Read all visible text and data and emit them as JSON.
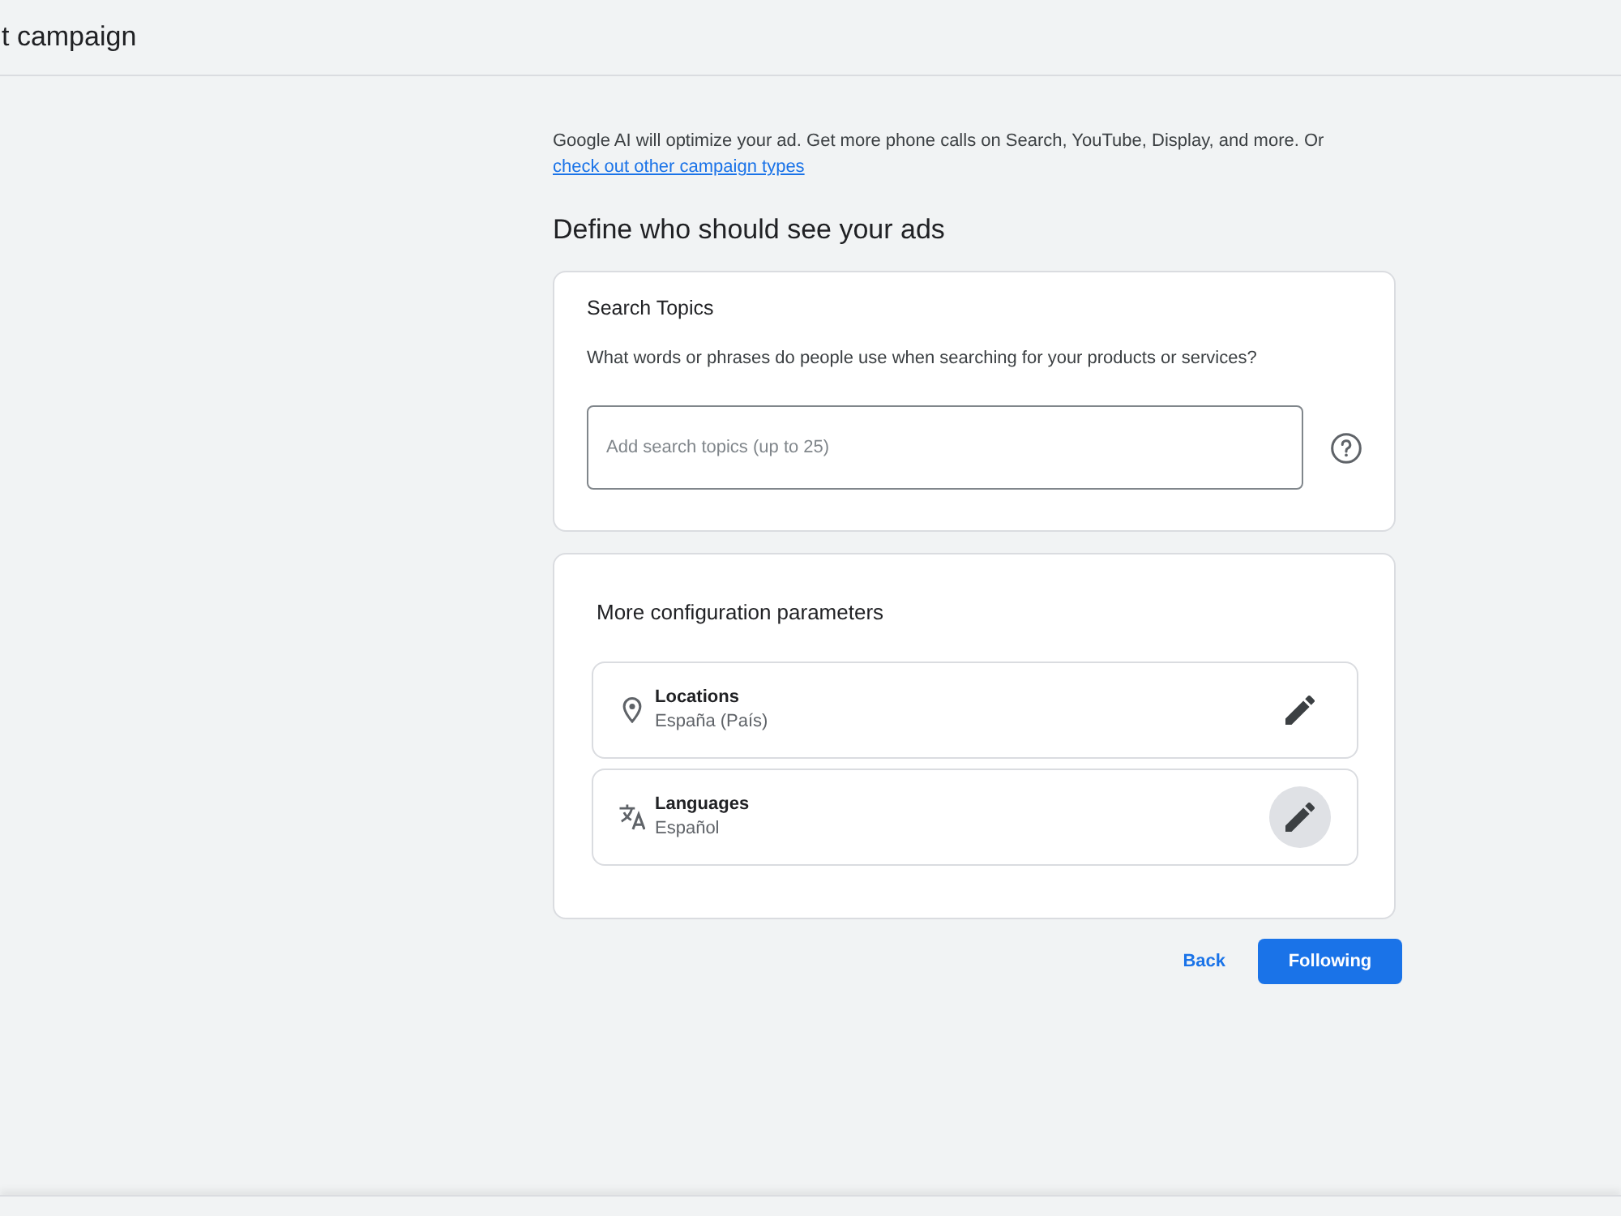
{
  "header": {
    "title": "t campaign"
  },
  "intro": {
    "text": "Google AI will optimize your ad. Get more phone calls on Search, YouTube, Display, and more. Or",
    "link": "check out other campaign types"
  },
  "heading": "Define who should see your ads",
  "search_topics": {
    "title": "Search Topics",
    "question": "What words or phrases do people use when searching for your products or services?",
    "placeholder": "Add search topics (up to 25)"
  },
  "config": {
    "title": "More configuration parameters",
    "items": [
      {
        "kind": "location",
        "label": "Locations",
        "value": "España (País)",
        "hovered": false
      },
      {
        "kind": "language",
        "label": "Languages",
        "value": "Español",
        "hovered": true
      }
    ]
  },
  "buttons": [
    {
      "kind": "text",
      "label": "Back"
    },
    {
      "kind": "primary",
      "label": "Following"
    }
  ]
}
